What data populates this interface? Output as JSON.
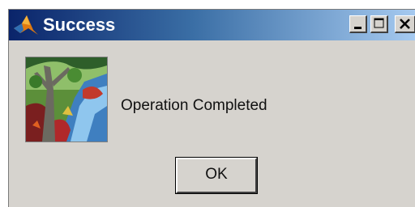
{
  "window": {
    "title": "Success",
    "app_icon": "matlab-logo-icon",
    "controls": {
      "minimize_icon": "minimize-icon",
      "maximize_icon": "maximize-icon",
      "close_icon": "close-icon"
    }
  },
  "dialog": {
    "image": "painting-tree-river-image",
    "message": "Operation Completed",
    "ok_label": "OK"
  },
  "colors": {
    "title_gradient_start": "#0a246a",
    "title_gradient_end": "#a6caf0",
    "window_background": "#d6d3ce"
  }
}
